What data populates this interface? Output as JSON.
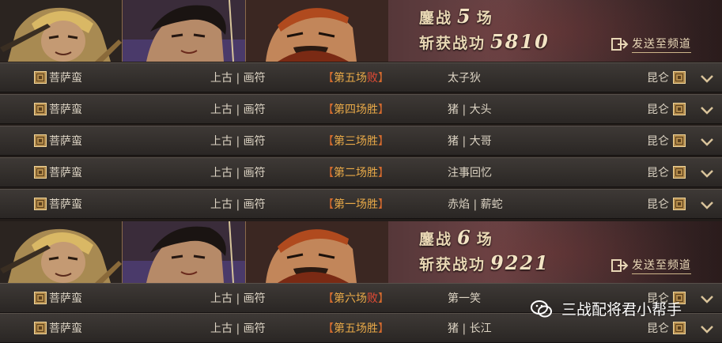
{
  "summaries": [
    {
      "line1_prefix": "鏖战",
      "round_count": "5",
      "line1_suffix": "场",
      "line2_prefix": "斩获战功",
      "merit": "5810",
      "send_label": "发送至频道"
    },
    {
      "line1_prefix": "鏖战",
      "round_count": "6",
      "line1_suffix": "场",
      "line2_prefix": "斩获战功",
      "merit": "9221",
      "send_label": "发送至频道"
    }
  ],
  "battles": [
    {
      "player": "菩萨蛮",
      "deck": "上古 | 画符",
      "round": "第五场",
      "result": "败",
      "opponent": "太子狄",
      "server": "昆仑"
    },
    {
      "player": "菩萨蛮",
      "deck": "上古 | 画符",
      "round": "第四场",
      "result": "胜",
      "opponent": "猪 | 大头",
      "server": "昆仑"
    },
    {
      "player": "菩萨蛮",
      "deck": "上古 | 画符",
      "round": "第三场",
      "result": "胜",
      "opponent": "猪 | 大哥",
      "server": "昆仑"
    },
    {
      "player": "菩萨蛮",
      "deck": "上古 | 画符",
      "round": "第二场",
      "result": "胜",
      "opponent": "注事回忆",
      "server": "昆仑"
    },
    {
      "player": "菩萨蛮",
      "deck": "上古 | 画符",
      "round": "第一场",
      "result": "胜",
      "opponent": "赤焰 | 薪蛇",
      "server": "昆仑"
    },
    {
      "player": "菩萨蛮",
      "deck": "上古 | 画符",
      "round": "第六场",
      "result": "败",
      "opponent": "第一笑",
      "server": "昆仑"
    },
    {
      "player": "菩萨蛮",
      "deck": "上古 | 画符",
      "round": "第五场",
      "result": "胜",
      "opponent": "猪 | 长江",
      "server": "昆仑"
    }
  ],
  "brackets": {
    "open": "【",
    "close": "】"
  },
  "watermark": {
    "text": "三战配将君小帮手",
    "icon": "wechat-icon"
  },
  "colors": {
    "win": "#e8a948",
    "lose": "#e64b35",
    "bracket": "#d46a2e",
    "title": "#e9d7b4"
  }
}
